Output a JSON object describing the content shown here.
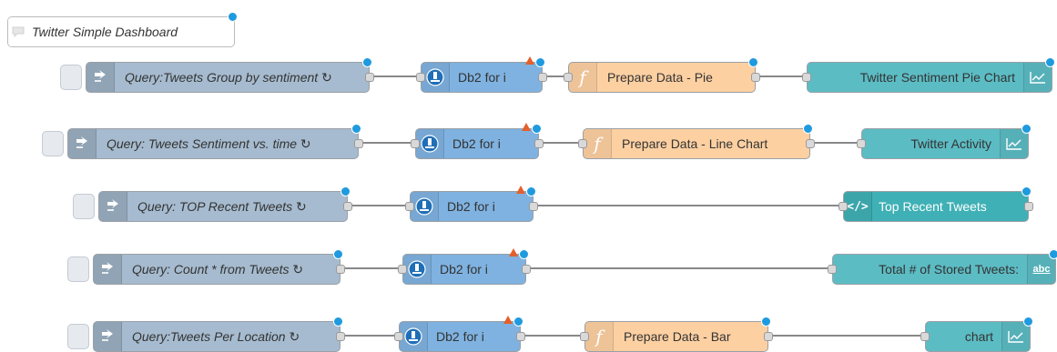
{
  "comment": {
    "label": "Twitter Simple Dashboard"
  },
  "flows": [
    {
      "inject": {
        "label": "Query:Tweets Group by sentiment",
        "icon": "arrow-right-icon"
      },
      "db2": {
        "label": "Db2 for i",
        "icon": "db2-icon"
      },
      "func": {
        "label": "Prepare Data - Pie",
        "icon": "function-icon"
      },
      "output": {
        "label": "Twitter Sentiment Pie Chart",
        "icon": "chart-icon"
      }
    },
    {
      "inject": {
        "label": "Query: Tweets Sentiment vs. time",
        "icon": "arrow-right-icon"
      },
      "db2": {
        "label": "Db2 for i",
        "icon": "db2-icon"
      },
      "func": {
        "label": "Prepare Data - Line Chart",
        "icon": "function-icon"
      },
      "output": {
        "label": "Twitter Activity",
        "icon": "chart-icon"
      }
    },
    {
      "inject": {
        "label": "Query: TOP Recent Tweets",
        "icon": "arrow-right-icon"
      },
      "db2": {
        "label": "Db2 for i",
        "icon": "db2-icon"
      },
      "output": {
        "label": "Top Recent Tweets",
        "icon": "template-icon"
      }
    },
    {
      "inject": {
        "label": "Query: Count * from Tweets",
        "icon": "arrow-right-icon"
      },
      "db2": {
        "label": "Db2 for i",
        "icon": "db2-icon"
      },
      "output": {
        "label": "Total # of Stored Tweets:",
        "icon": "text-icon",
        "icon_text": "abc"
      }
    },
    {
      "inject": {
        "label": "Query:Tweets Per Location",
        "icon": "arrow-right-icon"
      },
      "db2": {
        "label": "Db2 for i",
        "icon": "db2-icon"
      },
      "func": {
        "label": "Prepare Data - Bar",
        "icon": "function-icon"
      },
      "output": {
        "label": "chart",
        "icon": "chart-icon"
      }
    }
  ],
  "inject_suffix": "↻",
  "colors": {
    "inject": "#a6bbcf",
    "db2": "#7fb2e0",
    "function": "#fdd0a2",
    "dashboard": "#5cbcc4",
    "changed_dot": "#1f9ade",
    "warning": "#e45f2c"
  }
}
